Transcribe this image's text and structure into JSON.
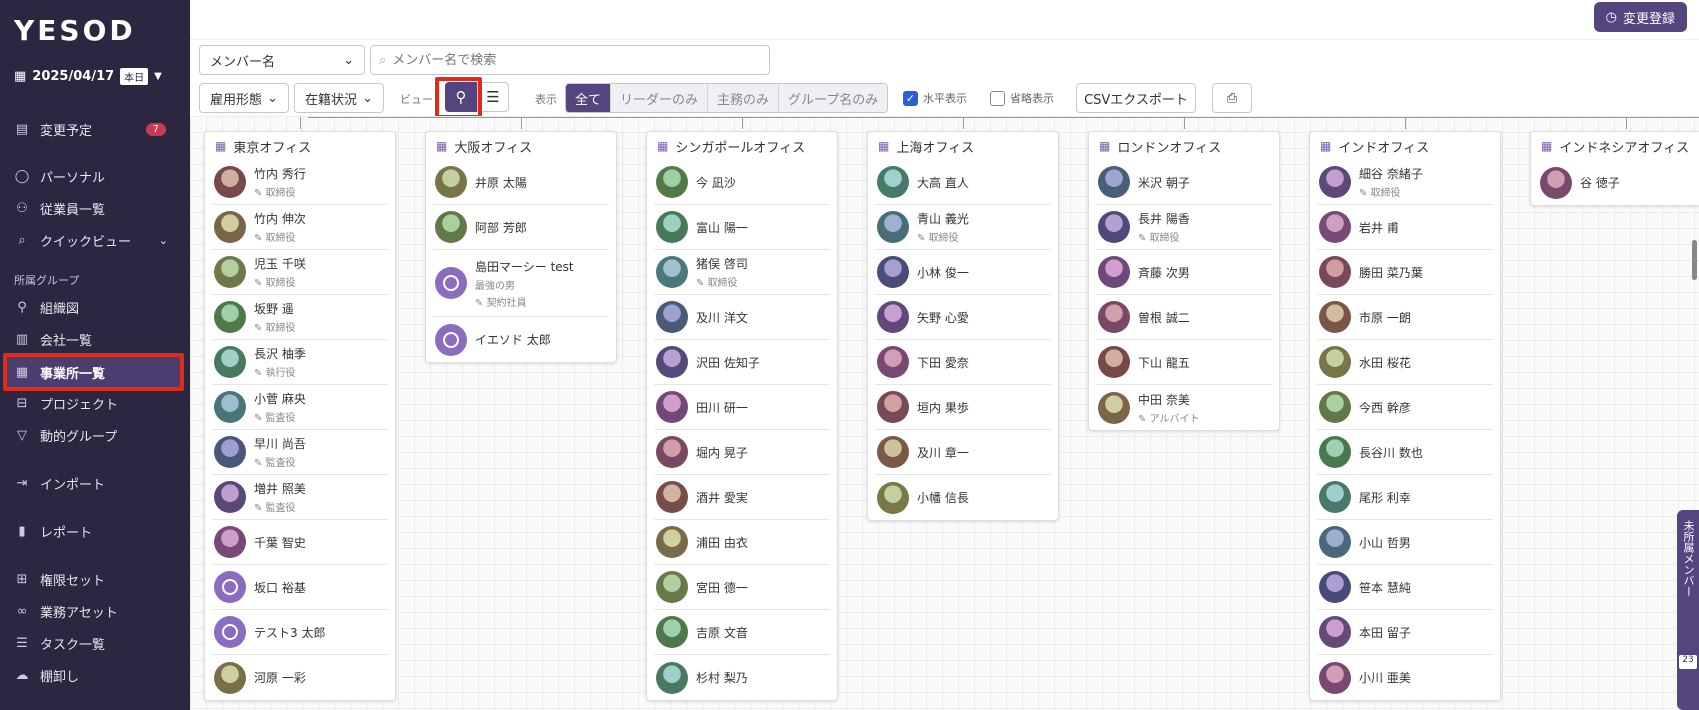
{
  "app": {
    "logo": "YESOD"
  },
  "date": {
    "value": "2025/04/17",
    "today_badge": "本日"
  },
  "sidebar": {
    "items_top": [
      {
        "label": "変更予定",
        "icon": "file-icon",
        "badge": "7"
      },
      {
        "label": "パーソナル",
        "icon": "person-icon"
      },
      {
        "label": "従業員一覧",
        "icon": "people-icon"
      },
      {
        "label": "クイックビュー",
        "icon": "search-icon"
      }
    ],
    "section_label": "所属グループ",
    "items_group": [
      {
        "label": "組織図",
        "icon": "org-chart-icon"
      },
      {
        "label": "会社一覧",
        "icon": "company-icon"
      },
      {
        "label": "事業所一覧",
        "icon": "office-icon"
      },
      {
        "label": "プロジェクト",
        "icon": "briefcase-icon"
      },
      {
        "label": "動的グループ",
        "icon": "filter-icon"
      }
    ],
    "items_bottom": [
      {
        "label": "インポート",
        "icon": "import-icon"
      },
      {
        "label": "レポート",
        "icon": "report-icon"
      },
      {
        "label": "権限セット",
        "icon": "grid-icon"
      },
      {
        "label": "業務アセット",
        "icon": "link-icon"
      },
      {
        "label": "タスク一覧",
        "icon": "tasklist-icon"
      },
      {
        "label": "棚卸し",
        "icon": "inventory-icon"
      }
    ]
  },
  "toolbar": {
    "change_register": "変更登録",
    "member_select": "メンバー名",
    "search_placeholder": "メンバー名で検索",
    "employment_type": "雇用形態",
    "enrollment_status": "在籍状況",
    "view_label": "ビュー",
    "display_label": "表示",
    "display_options": [
      "全て",
      "リーダーのみ",
      "主務のみ",
      "グループ名のみ"
    ],
    "horizontal_label": "水平表示",
    "abbrev_label": "省略表示",
    "csv_export": "CSVエクスポート"
  },
  "offices": [
    {
      "name": "東京オフィス",
      "members": [
        {
          "name": "竹内 秀行",
          "role": "取締役"
        },
        {
          "name": "竹内 伸次",
          "role": "取締役"
        },
        {
          "name": "児玉 千咲",
          "role": "取締役"
        },
        {
          "name": "坂野 遥",
          "role": "取締役"
        },
        {
          "name": "長沢 柚季",
          "role": "執行役"
        },
        {
          "name": "小菅 麻央",
          "role": "監査役"
        },
        {
          "name": "早川 尚吾",
          "role": "監査役"
        },
        {
          "name": "増井 照美",
          "role": "監査役"
        },
        {
          "name": "千葉 智史"
        },
        {
          "name": "坂口 裕基",
          "placeholder": true
        },
        {
          "name": "テスト3 太郎",
          "placeholder": true
        },
        {
          "name": "河原 一彩"
        }
      ]
    },
    {
      "name": "大阪オフィス",
      "members": [
        {
          "name": "井原 太陽"
        },
        {
          "name": "阿部 芳郎"
        },
        {
          "name": "島田マーシー test",
          "sub": "最強の男",
          "role": "契約社員",
          "placeholder": true
        },
        {
          "name": "イエソド 太郎",
          "placeholder": true
        }
      ]
    },
    {
      "name": "シンガポールオフィス",
      "members": [
        {
          "name": "今 凪沙"
        },
        {
          "name": "富山 陽一"
        },
        {
          "name": "猪俣 啓司",
          "role": "取締役"
        },
        {
          "name": "及川 洋文"
        },
        {
          "name": "沢田 佐知子"
        },
        {
          "name": "田川 研一"
        },
        {
          "name": "堀内 晃子"
        },
        {
          "name": "酒井 愛実"
        },
        {
          "name": "浦田 由衣"
        },
        {
          "name": "宮田 德一"
        },
        {
          "name": "吉原 文音"
        },
        {
          "name": "杉村 梨乃"
        }
      ]
    },
    {
      "name": "上海オフィス",
      "members": [
        {
          "name": "大高 直人"
        },
        {
          "name": "青山 義光",
          "role": "取締役"
        },
        {
          "name": "小林 俊一"
        },
        {
          "name": "矢野 心愛"
        },
        {
          "name": "下田 愛奈"
        },
        {
          "name": "垣内 果歩"
        },
        {
          "name": "及川 章一"
        },
        {
          "name": "小幡 信長"
        }
      ]
    },
    {
      "name": "ロンドンオフィス",
      "members": [
        {
          "name": "米沢 朝子"
        },
        {
          "name": "長井 陽香",
          "role": "取締役"
        },
        {
          "name": "斉藤 次男"
        },
        {
          "name": "曽根 誠二"
        },
        {
          "name": "下山 龍五"
        },
        {
          "name": "中田 奈美",
          "role": "アルバイト"
        }
      ]
    },
    {
      "name": "インドオフィス",
      "members": [
        {
          "name": "細谷 奈緒子",
          "role": "取締役"
        },
        {
          "name": "岩井 甫"
        },
        {
          "name": "勝田 菜乃葉"
        },
        {
          "name": "市原 一朗"
        },
        {
          "name": "水田 桜花"
        },
        {
          "name": "今西 幹彦"
        },
        {
          "name": "長谷川 数也"
        },
        {
          "name": "尾形 利幸"
        },
        {
          "name": "小山 哲男"
        },
        {
          "name": "笹本 慧純"
        },
        {
          "name": "本田 留子"
        },
        {
          "name": "小川 亜美"
        }
      ]
    },
    {
      "name": "インドネシアオフィス",
      "members": [
        {
          "name": "谷 徳子"
        }
      ]
    }
  ],
  "side_tab": {
    "label": "未所属メンバー",
    "count": "23"
  },
  "colors": {
    "accent": "#55457f",
    "sidebar": "#2c2640",
    "highlight": "#e02a1a"
  }
}
